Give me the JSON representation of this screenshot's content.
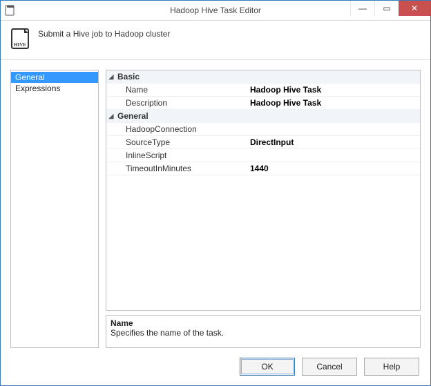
{
  "window": {
    "title": "Hadoop Hive Task Editor"
  },
  "header": {
    "subtitle": "Submit a Hive job to Hadoop cluster",
    "icon_label": "HIVE"
  },
  "nav": {
    "items": [
      "General",
      "Expressions"
    ],
    "selected_index": 0
  },
  "grid": {
    "groups": [
      {
        "name": "Basic",
        "rows": [
          {
            "key": "Name",
            "value": "Hadoop Hive Task"
          },
          {
            "key": "Description",
            "value": "Hadoop Hive Task"
          }
        ]
      },
      {
        "name": "General",
        "rows": [
          {
            "key": "HadoopConnection",
            "value": ""
          },
          {
            "key": "SourceType",
            "value": "DirectInput"
          },
          {
            "key": "InlineScript",
            "value": ""
          },
          {
            "key": "TimeoutInMinutes",
            "value": "1440"
          }
        ]
      }
    ]
  },
  "description": {
    "title": "Name",
    "text": "Specifies the name of the task."
  },
  "buttons": {
    "ok": "OK",
    "cancel": "Cancel",
    "help": "Help"
  },
  "glyphs": {
    "expand": "◢",
    "minimize": "—",
    "maximize": "▭",
    "close": "✕"
  }
}
